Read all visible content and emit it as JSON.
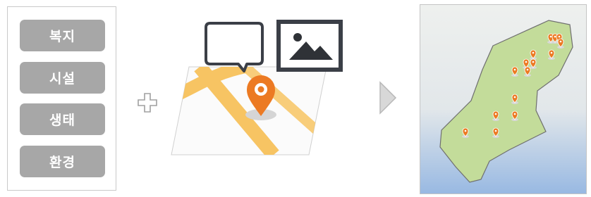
{
  "categories": [
    {
      "label": "복지"
    },
    {
      "label": "시설"
    },
    {
      "label": "생태"
    },
    {
      "label": "환경"
    }
  ],
  "icons": {
    "plus": "plus-icon",
    "speech": "speech-bubble-icon",
    "image": "image-icon",
    "pin": "location-pin-icon",
    "arrow": "play-arrow-icon"
  },
  "colors": {
    "button_gray": "#a7a7a7",
    "road_yellow": "#f7c463",
    "pin_orange": "#ec7a23",
    "region_green": "#c3dc9a",
    "map_blue": "#97b8e2"
  }
}
